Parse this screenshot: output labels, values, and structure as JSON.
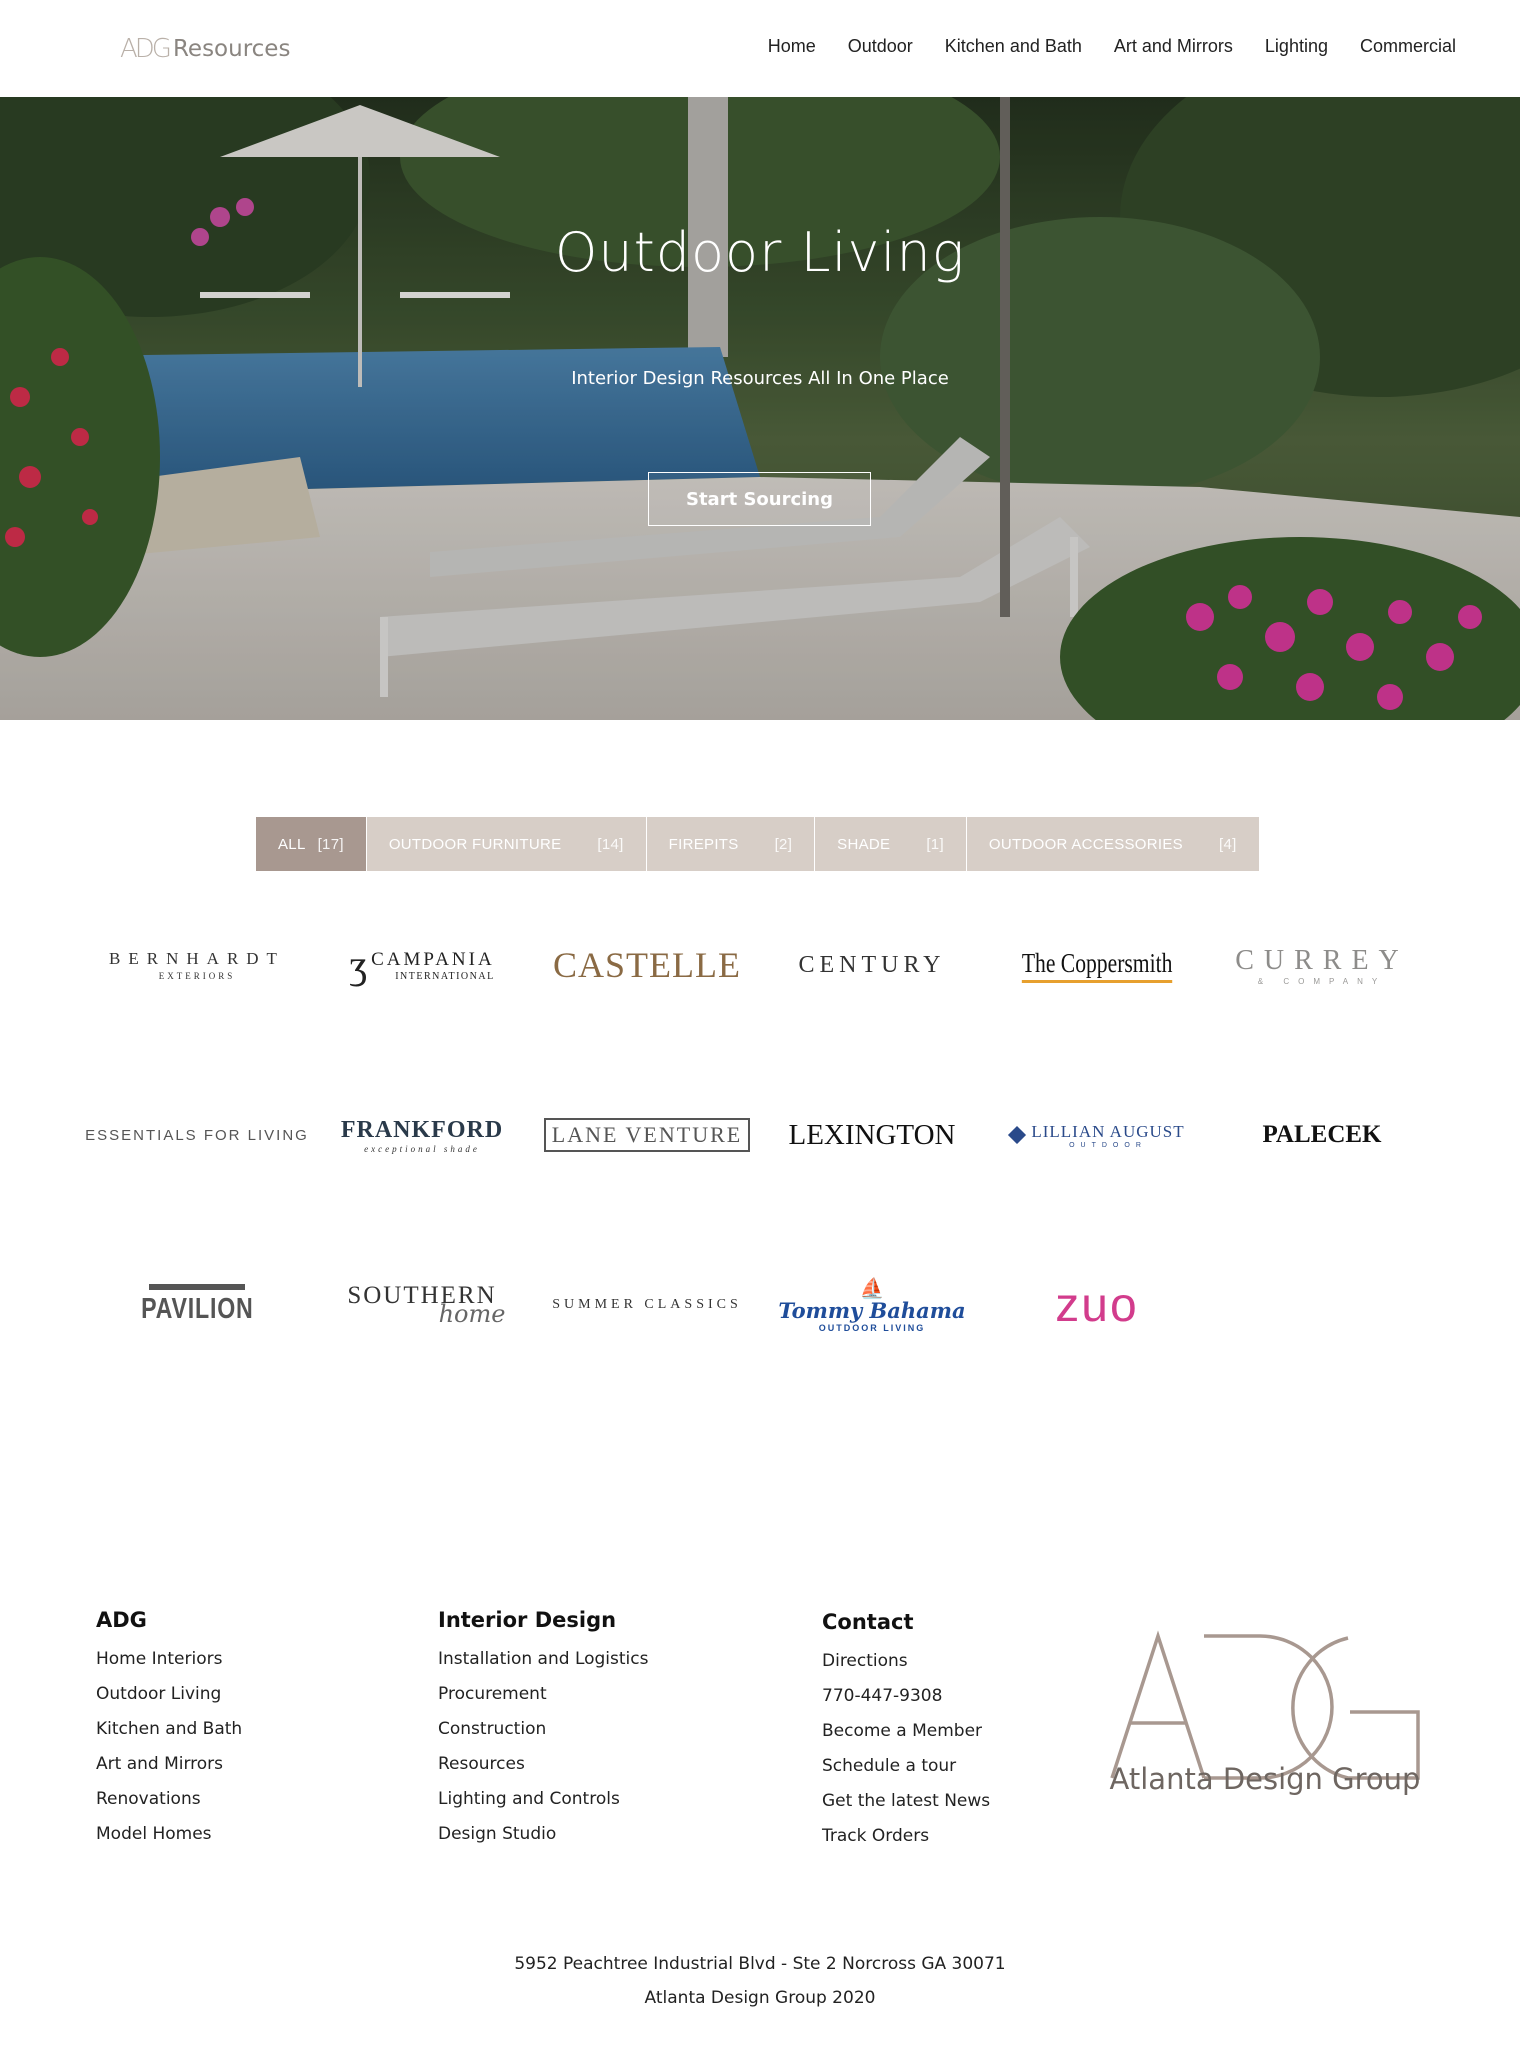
{
  "header": {
    "logo_mark": "ADG",
    "logo_text": "Resources",
    "nav": [
      "Home",
      "Outdoor",
      "Kitchen and Bath",
      "Art and Mirrors",
      "Lighting",
      "Commercial"
    ]
  },
  "hero": {
    "title": "Outdoor Living",
    "subtitle": "Interior Design Resources All In One Place",
    "button": "Start Sourcing"
  },
  "filters": [
    {
      "label": "ALL",
      "count": "[17]",
      "active": true
    },
    {
      "label": "OUTDOOR FURNITURE",
      "count": "[14]",
      "active": false
    },
    {
      "label": "FIREPITS",
      "count": "[2]",
      "active": false
    },
    {
      "label": "SHADE",
      "count": "[1]",
      "active": false
    },
    {
      "label": "OUTDOOR ACCESSORIES",
      "count": "[4]",
      "active": false
    }
  ],
  "brands": [
    {
      "name": "BERNHARDT",
      "sub": "EXTERIORS"
    },
    {
      "name": "CAMPANIA",
      "sub": "INTERNATIONAL"
    },
    {
      "name": "CASTELLE",
      "sub": ""
    },
    {
      "name": "CENTURY",
      "sub": ""
    },
    {
      "name": "The Coppersmith",
      "sub": ""
    },
    {
      "name": "CURREY",
      "sub": "& COMPANY"
    },
    {
      "name": "ESSENTIALS FOR LIVING",
      "sub": ""
    },
    {
      "name": "FRANKFORD",
      "sub": "exceptional shade"
    },
    {
      "name": "LANE VENTURE",
      "sub": ""
    },
    {
      "name": "LEXINGTON",
      "sub": ""
    },
    {
      "name": "LILLIAN AUGUST",
      "sub": "OUTDOOR"
    },
    {
      "name": "PALECEK",
      "sub": ""
    },
    {
      "name": "PAVILION",
      "sub": ""
    },
    {
      "name": "SOUTHERN",
      "sub": "home"
    },
    {
      "name": "SUMMER CLASSICS",
      "sub": ""
    },
    {
      "name": "Tommy Bahama",
      "sub": "OUTDOOR LIVING"
    },
    {
      "name": "ZUO",
      "sub": ""
    }
  ],
  "footer": {
    "columns": [
      {
        "title": "ADG",
        "links": [
          "Home Interiors",
          "Outdoor Living",
          "Kitchen and Bath",
          "Art and Mirrors",
          "Renovations",
          "Model Homes"
        ]
      },
      {
        "title": "Interior Design",
        "links": [
          "Installation and Logistics",
          "Procurement",
          "Construction",
          "Resources",
          "Lighting and Controls",
          "Design Studio"
        ]
      },
      {
        "title": "Contact",
        "links": [
          "Directions",
          "770-447-9308",
          "Become a Member",
          "Schedule a tour",
          "Get the latest News",
          "Track Orders"
        ]
      }
    ],
    "logo_mark": "ADG",
    "logo_name": "Atlanta Design Group",
    "address": "5952 Peachtree Industrial Blvd - Ste 2 Norcross GA 30071",
    "copyright": "Atlanta Design Group 2020"
  },
  "colors": {
    "filter_active": "#a89890",
    "filter_inactive": "#d7cec7",
    "brand_castelle": "#8a6a44",
    "brand_zuo": "#d23c8c",
    "brand_tommy": "#1f4d9a"
  }
}
